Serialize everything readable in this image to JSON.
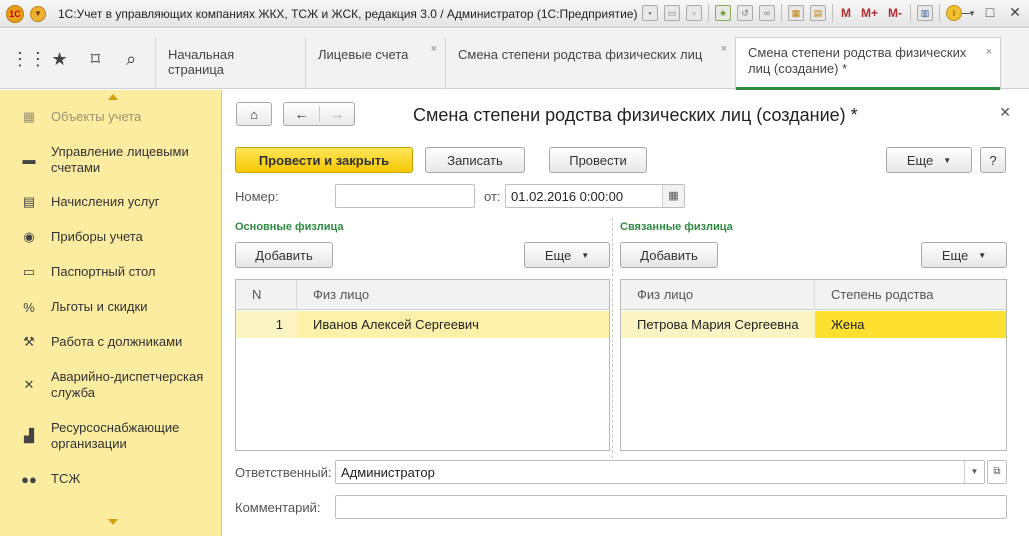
{
  "window": {
    "title": "1С:Учет в управляющих компаниях ЖКХ, ТСЖ и ЖСК, редакция 3.0 / Администратор  (1С:Предприятие)",
    "logo_text": "1С",
    "toolbar_memory": [
      "M",
      "M+",
      "M-"
    ]
  },
  "tabs": [
    {
      "label": "Начальная страница",
      "closable": false
    },
    {
      "label": "Лицевые счета",
      "closable": true
    },
    {
      "label": "Смена степени родства физических лиц",
      "closable": true
    },
    {
      "label": "Смена степени родства физических лиц (создание) *",
      "closable": true,
      "active": true
    }
  ],
  "sidebar": {
    "items": [
      {
        "label": "Объекты учета",
        "icon": "building-icon"
      },
      {
        "label": "Управление лицевыми счетами",
        "icon": "accounts-icon"
      },
      {
        "label": "Начисления услуг",
        "icon": "calculator-icon"
      },
      {
        "label": "Приборы учета",
        "icon": "meter-icon"
      },
      {
        "label": "Паспортный стол",
        "icon": "passport-icon"
      },
      {
        "label": "Льготы и скидки",
        "icon": "percent-icon"
      },
      {
        "label": "Работа с должниками",
        "icon": "gavel-icon"
      },
      {
        "label": "Аварийно-диспетчерская служба",
        "icon": "tools-icon"
      },
      {
        "label": "Ресурсоснабжающие организации",
        "icon": "factory-icon"
      },
      {
        "label": "ТСЖ",
        "icon": "people-icon"
      }
    ]
  },
  "form": {
    "title": "Смена степени родства физических лиц (создание) *",
    "buttons": {
      "post_close": "Провести и закрыть",
      "save": "Записать",
      "post": "Провести",
      "more": "Еще",
      "help": "?"
    },
    "number_label": "Номер:",
    "number_value": "",
    "date_label": "от:",
    "date_value": "01.02.2016  0:00:00",
    "left_section": {
      "title": "Основные физлица",
      "add": "Добавить",
      "more": "Еще",
      "columns": [
        "N",
        "Физ лицо"
      ],
      "rows": [
        {
          "n": "1",
          "person": "Иванов Алексей Сергеевич"
        }
      ]
    },
    "right_section": {
      "title": "Связанные физлица",
      "add": "Добавить",
      "more": "Еще",
      "columns": [
        "Физ лицо",
        "Степень родства"
      ],
      "rows": [
        {
          "person": "Петрова Мария Сергеевна",
          "relation": "Жена"
        }
      ]
    },
    "responsible_label": "Ответственный:",
    "responsible_value": "Администратор",
    "comment_label": "Комментарий:",
    "comment_value": ""
  },
  "colors": {
    "sidebar_bg": "#fbeca0",
    "primary_button": "#f5c800",
    "section_title": "#2e8b3e",
    "selected_row": "#fbf3c2",
    "selected_cell": "#fde030"
  }
}
